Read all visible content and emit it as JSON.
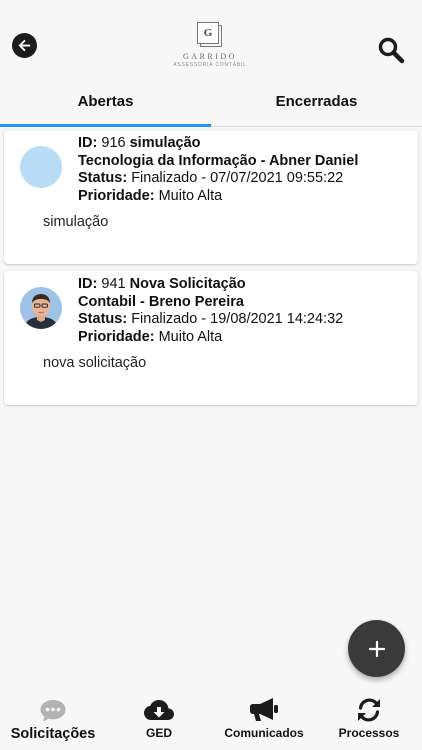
{
  "header": {
    "logo": {
      "letter": "G",
      "name": "GARRIDO",
      "subtitle": "ASSESSORIA CONTÁBIL"
    }
  },
  "tabs": [
    {
      "label": "Abertas",
      "active": true
    },
    {
      "label": "Encerradas",
      "active": false
    }
  ],
  "labels": {
    "id": "ID:",
    "status": "Status:",
    "priority": "Prioridade:"
  },
  "requests": [
    {
      "id": "916",
      "title": "simulação",
      "department_user": "Tecnologia da Informação - Abner Daniel",
      "status": "Finalizado - 07/07/2021 09:55:22",
      "priority": "Muito Alta",
      "description": "simulação",
      "avatar": "placeholder"
    },
    {
      "id": "941",
      "title": "Nova Solicitação",
      "department_user": "Contabil - Breno Pereira",
      "status": "Finalizado - 19/08/2021 14:24:32",
      "priority": "Muito Alta",
      "description": "nova solicitação",
      "avatar": "photo"
    }
  ],
  "fab": {
    "icon": "plus-icon"
  },
  "bottom_nav": [
    {
      "label": "Solicitações",
      "icon": "chat-bubble-icon",
      "active": true
    },
    {
      "label": "GED",
      "icon": "cloud-download-icon",
      "active": false
    },
    {
      "label": "Comunicados",
      "icon": "megaphone-icon",
      "active": false
    },
    {
      "label": "Processos",
      "icon": "sync-icon",
      "active": false
    }
  ],
  "colors": {
    "accent": "#2196f3",
    "avatar_placeholder": "#b9dcf6",
    "fab": "#3a3a3a"
  }
}
